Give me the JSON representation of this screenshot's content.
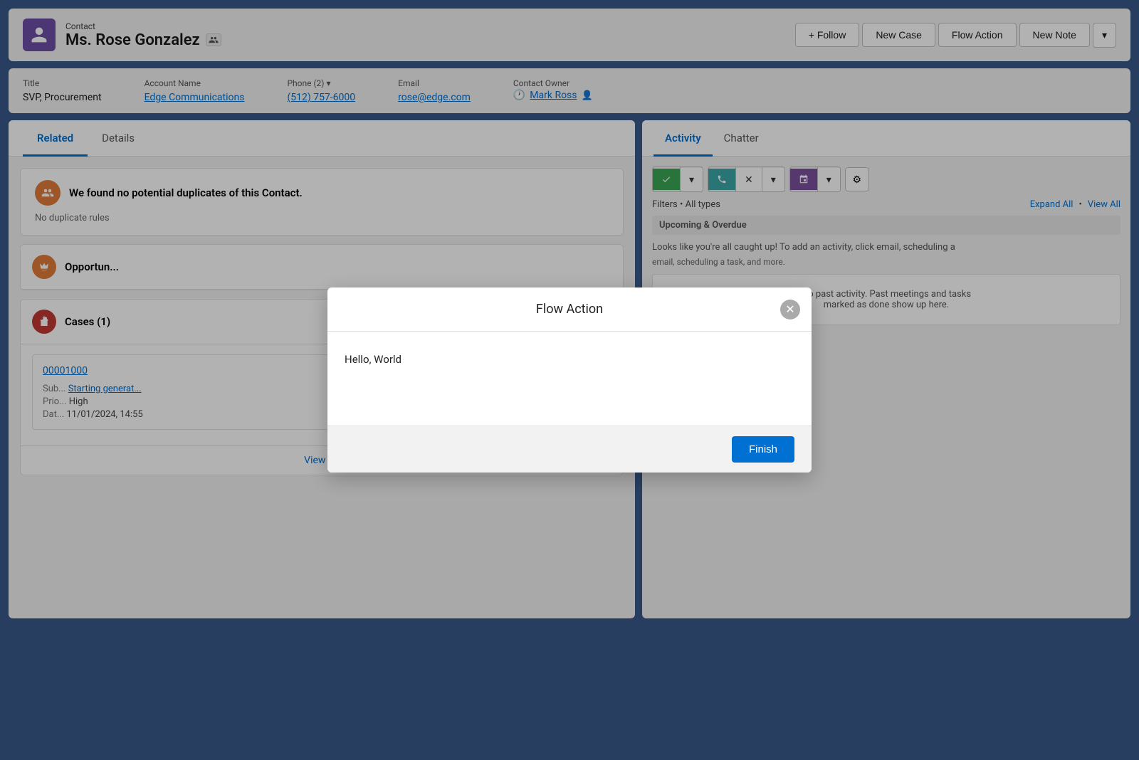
{
  "header": {
    "contact_type": "Contact",
    "contact_name": "Ms. Rose Gonzalez",
    "follow_label": "+ Follow",
    "new_case_label": "New Case",
    "flow_action_label": "Flow Action",
    "new_note_label": "New Note",
    "dropdown_label": "▾"
  },
  "info": {
    "title_label": "Title",
    "title_value": "SVP, Procurement",
    "account_label": "Account Name",
    "account_value": "Edge Communications",
    "phone_label": "Phone (2)",
    "phone_value": "(512) 757-6000",
    "email_label": "Email",
    "email_value": "rose@edge.com",
    "owner_label": "Contact Owner",
    "owner_value": "Mark Ross"
  },
  "left_panel": {
    "tab_related": "Related",
    "tab_details": "Details",
    "duplicate_title": "We found no potential duplicates of this Contact.",
    "duplicate_body": "No duplicate rules",
    "opportunity_title": "Opportun...",
    "cases_title": "Cases (1)",
    "case_id": "00001000",
    "case_sub_label": "Sub...",
    "case_sub_value": "Starting generat...",
    "case_prio_label": "Prio...",
    "case_prio_value": "High",
    "case_dat_label": "Dat...",
    "case_dat_value": "11/01/2024, 14:55",
    "view_all": "View All"
  },
  "right_panel": {
    "tab_activity": "Activity",
    "tab_chatter": "Chatter",
    "filter_text": "Filters • All types",
    "expand_all": "Expand All",
    "view_all": "View All",
    "upcoming_title": "Upcoming & Overdue",
    "upcoming_hint": "Looks like you're all caught up! To add an activity, click email, scheduling a task, and more.",
    "upcoming_hint2": "email, scheduling a task, and more.",
    "no_past": "No past activity. Past meetings and tasks",
    "no_past2": "marked as done show up here."
  },
  "modal": {
    "title": "Flow Action",
    "body_text": "Hello, World",
    "finish_label": "Finish"
  },
  "icons": {
    "contact": "👤",
    "chevron_down": "▾",
    "plus": "+",
    "person_merge": "⟐",
    "opportunity": "👑",
    "cases": "🗂",
    "task": "✓",
    "call": "📞",
    "calendar": "📅",
    "gear": "⚙",
    "clock": "🕐",
    "person": "👤"
  }
}
